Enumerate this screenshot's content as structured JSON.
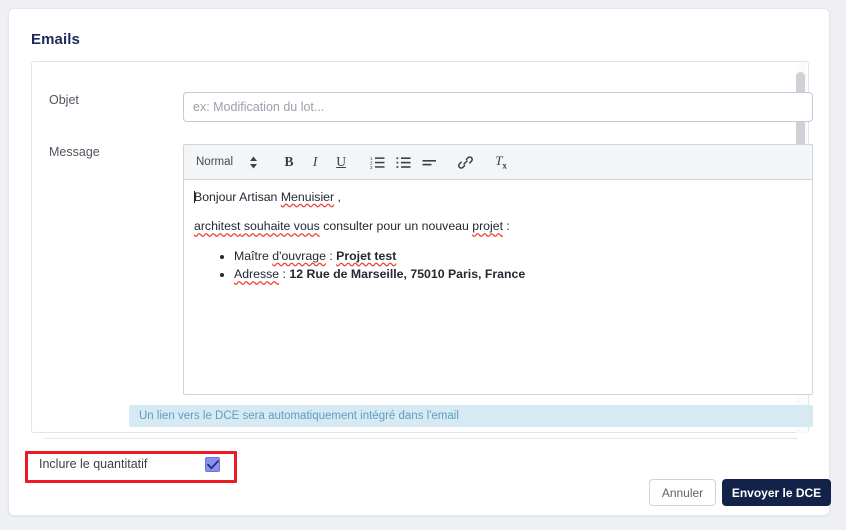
{
  "page": {
    "card_title": "Emails"
  },
  "form": {
    "objet": {
      "label": "Objet",
      "value": "",
      "placeholder": "ex: Modification du lot..."
    },
    "message": {
      "label": "Message",
      "toolbar": {
        "format_select": "Normal",
        "buttons": [
          {
            "name": "bold-icon",
            "label": "B"
          },
          {
            "name": "italic-icon",
            "label": "I"
          },
          {
            "name": "underline-icon",
            "label": "U"
          },
          {
            "name": "ordered-list-icon",
            "label": ""
          },
          {
            "name": "bullet-list-icon",
            "label": ""
          },
          {
            "name": "align-left-icon",
            "label": ""
          },
          {
            "name": "link-icon",
            "label": ""
          },
          {
            "name": "clear-format-icon",
            "label": "T"
          }
        ]
      },
      "body": {
        "greeting_prefix": "Bonjour Artisan ",
        "greeting_name": "Menuisier",
        "greeting_suffix": " ,",
        "intro_sender": "architest",
        "intro_mid": " souhaite vous",
        "intro_rest": " consulter pour un nouveau ",
        "intro_word": "projet",
        "intro_colon": " :",
        "items": [
          {
            "key": "Maître d'ouvrage",
            "key_plain": "Maître ",
            "key_sp": "d'ouvrage",
            "sep": " : ",
            "value": "Projet test"
          },
          {
            "key": "Adresse",
            "key_plain": "",
            "key_sp": "Adresse",
            "sep": " : ",
            "value": "12 Rue de Marseille, 75010 Paris, France"
          }
        ]
      }
    },
    "info_banner": "Un lien vers le DCE sera automatiquement intégré dans l'email"
  },
  "options": {
    "include_quantitatif": {
      "label": "Inclure le quantitatif",
      "checked": true
    }
  },
  "footer": {
    "cancel_label": "Annuler",
    "send_label": "Envoyer le DCE"
  },
  "colors": {
    "brand_navy": "#132248",
    "info_bg": "#d7eaf3",
    "info_text": "#5b9fbf",
    "checkbox_fill": "#8b90f0",
    "highlight_red": "#ee1b24",
    "page_bg": "#eef0f4"
  }
}
